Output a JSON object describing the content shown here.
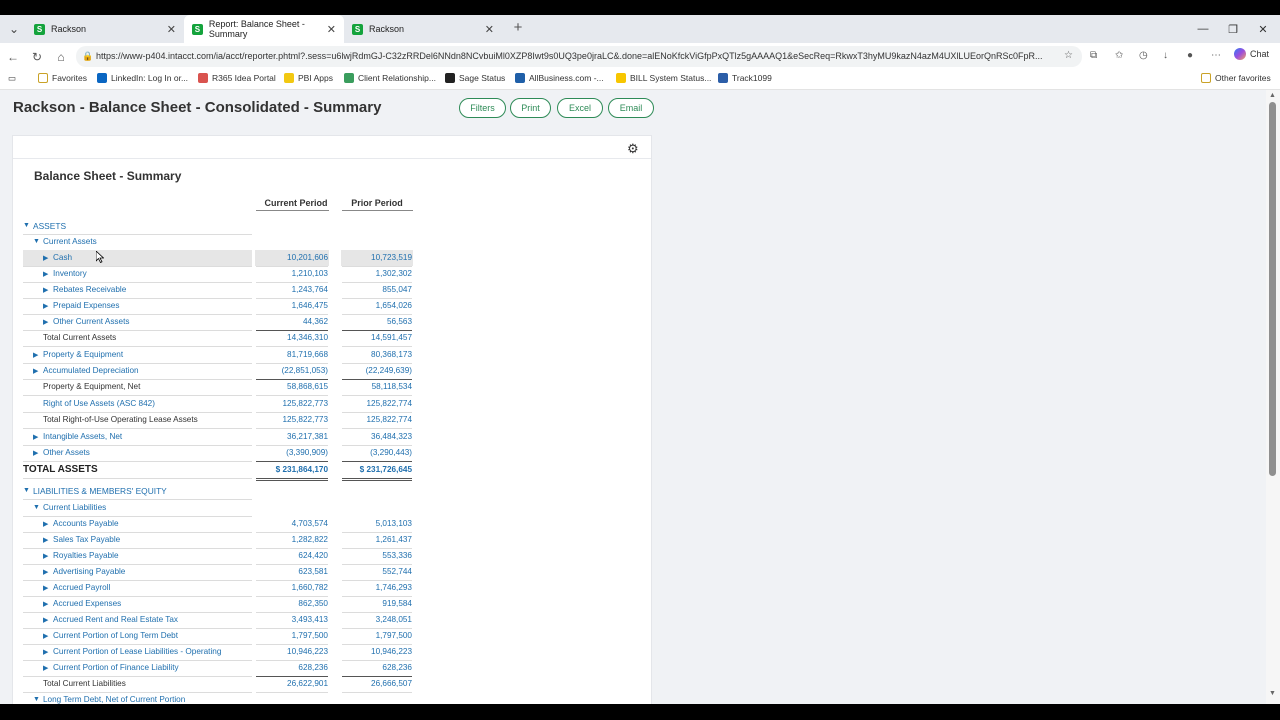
{
  "tabs": [
    {
      "title": "Rackson"
    },
    {
      "title": "Report: Balance Sheet - Summary"
    },
    {
      "title": "Rackson"
    }
  ],
  "address": {
    "url": "https://www-p404.intacct.com/ia/acct/reporter.phtml?.sess=u6lwjRdmGJ-C32zRRDel6NNdn8NCvbuiMl0XZP8Iwt9s0UQ3pe0jraLC&.done=alENoKfckViGfpPxQTlz5gAAAAQ1&eSecReq=RkwxT3hyMU9kazN4azM4UXlLUEorQnRSc0FpR..."
  },
  "browser": {
    "chat_label": "Chat"
  },
  "favorites": [
    {
      "label": "Favorites",
      "color": "#c9a227"
    },
    {
      "label": "LinkedIn: Log In or...",
      "color": "#0a66c2"
    },
    {
      "label": "R365 Idea Portal",
      "color": "#d9534f"
    },
    {
      "label": "PBI Apps",
      "color": "#f2c811"
    },
    {
      "label": "Client Relationship...",
      "color": "#3a9d5d"
    },
    {
      "label": "Sage Status",
      "color": "#222"
    },
    {
      "label": "AllBusiness.com -...",
      "color": "#1f5fa8"
    },
    {
      "label": "BILL System Status...",
      "color": "#f7c600"
    },
    {
      "label": "Track1099",
      "color": "#2c5ea8"
    },
    {
      "label": "Other favorites",
      "color": "#c9a227"
    }
  ],
  "page": {
    "title": "Rackson - Balance Sheet - Consolidated - Summary",
    "buttons": [
      "Filters",
      "Print",
      "Excel",
      "Email"
    ]
  },
  "report": {
    "title": "Balance Sheet - Summary",
    "col1": "Current Period",
    "col2": "Prior Period",
    "rows": [
      {
        "label": "ASSETS",
        "kind": "section",
        "indent": 0,
        "tri": "down"
      },
      {
        "label": "Current Assets",
        "kind": "link",
        "indent": 1,
        "tri": "down"
      },
      {
        "label": "Cash",
        "kind": "link",
        "indent": 2,
        "tri": "right",
        "v1": "10,201,606",
        "v2": "10,723,519",
        "highlight": true
      },
      {
        "label": "Inventory",
        "kind": "link",
        "indent": 2,
        "tri": "right",
        "v1": "1,210,103",
        "v2": "1,302,302"
      },
      {
        "label": "Rebates Receivable",
        "kind": "link",
        "indent": 2,
        "tri": "right",
        "v1": "1,243,764",
        "v2": "855,047"
      },
      {
        "label": "Prepaid Expenses",
        "kind": "link",
        "indent": 2,
        "tri": "right",
        "v1": "1,646,475",
        "v2": "1,654,026"
      },
      {
        "label": "Other Current Assets",
        "kind": "link",
        "indent": 2,
        "tri": "right",
        "v1": "44,362",
        "v2": "56,563"
      },
      {
        "label": "Total Current Assets",
        "kind": "total",
        "indent": 1,
        "v1": "14,346,310",
        "v2": "14,591,457"
      },
      {
        "label": "Property & Equipment",
        "kind": "link",
        "indent": 1,
        "tri": "right",
        "v1": "81,719,668",
        "v2": "80,368,173"
      },
      {
        "label": "Accumulated Depreciation",
        "kind": "link",
        "indent": 1,
        "tri": "right",
        "v1": "(22,851,053)",
        "v2": "(22,249,639)"
      },
      {
        "label": "Property & Equipment, Net",
        "kind": "total",
        "indent": 1,
        "v1": "58,868,615",
        "v2": "58,118,534"
      },
      {
        "label": "Right of Use Assets (ASC 842)",
        "kind": "link",
        "indent": 1,
        "v1": "125,822,773",
        "v2": "125,822,774"
      },
      {
        "label": "Total Right-of-Use Operating Lease Assets",
        "kind": "total",
        "indent": 1,
        "v1": "125,822,773",
        "v2": "125,822,774"
      },
      {
        "label": "Intangible Assets, Net",
        "kind": "link",
        "indent": 1,
        "tri": "right",
        "v1": "36,217,381",
        "v2": "36,484,323"
      },
      {
        "label": "Other Assets",
        "kind": "link",
        "indent": 1,
        "tri": "right",
        "v1": "(3,390,909)",
        "v2": "(3,290,443)"
      },
      {
        "label": "TOTAL ASSETS",
        "kind": "grand",
        "indent": 0,
        "v1": "$ 231,864,170",
        "v2": "$ 231,726,645"
      },
      {
        "label": "LIABILITIES & MEMBERS' EQUITY",
        "kind": "section",
        "indent": 0,
        "tri": "down"
      },
      {
        "label": "Current Liabilities",
        "kind": "link",
        "indent": 1,
        "tri": "down"
      },
      {
        "label": "Accounts Payable",
        "kind": "link",
        "indent": 2,
        "tri": "right",
        "v1": "4,703,574",
        "v2": "5,013,103"
      },
      {
        "label": "Sales Tax Payable",
        "kind": "link",
        "indent": 2,
        "tri": "right",
        "v1": "1,282,822",
        "v2": "1,261,437"
      },
      {
        "label": "Royalties Payable",
        "kind": "link",
        "indent": 2,
        "tri": "right",
        "v1": "624,420",
        "v2": "553,336"
      },
      {
        "label": "Advertising Payable",
        "kind": "link",
        "indent": 2,
        "tri": "right",
        "v1": "623,581",
        "v2": "552,744"
      },
      {
        "label": "Accrued Payroll",
        "kind": "link",
        "indent": 2,
        "tri": "right",
        "v1": "1,660,782",
        "v2": "1,746,293"
      },
      {
        "label": "Accrued Expenses",
        "kind": "link",
        "indent": 2,
        "tri": "right",
        "v1": "862,350",
        "v2": "919,584"
      },
      {
        "label": "Accrued Rent and Real Estate Tax",
        "kind": "link",
        "indent": 2,
        "tri": "right",
        "v1": "3,493,413",
        "v2": "3,248,051"
      },
      {
        "label": "Current Portion of Long Term Debt",
        "kind": "link",
        "indent": 2,
        "tri": "right",
        "v1": "1,797,500",
        "v2": "1,797,500"
      },
      {
        "label": "Current Portion of Lease Liabilities - Operating",
        "kind": "link",
        "indent": 2,
        "tri": "right",
        "v1": "10,946,223",
        "v2": "10,946,223"
      },
      {
        "label": "Current Portion of Finance Liability",
        "kind": "link",
        "indent": 2,
        "tri": "right",
        "v1": "628,236",
        "v2": "628,236"
      },
      {
        "label": "Total Current Liabilities",
        "kind": "total",
        "indent": 1,
        "v1": "26,622,901",
        "v2": "26,666,507"
      },
      {
        "label": "Long Term Debt, Net of Current Portion",
        "kind": "link",
        "indent": 1,
        "tri": "down"
      }
    ]
  }
}
